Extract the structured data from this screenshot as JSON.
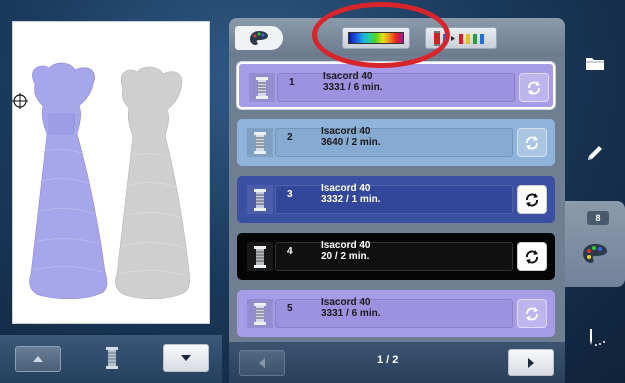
{
  "header": {
    "colorbar_button": "color-shuffle",
    "sort_button": "thread-sort"
  },
  "threads": [
    {
      "num": "1",
      "name": "Isacord 40",
      "info": "3331 / 6 min.",
      "row_color": "#a79ce8",
      "label_color": "#9d92e0",
      "text_color": "#1a1a1a",
      "selected": true
    },
    {
      "num": "2",
      "name": "Isacord 40",
      "info": "3640 / 2 min.",
      "row_color": "#8fb3da",
      "label_color": "#86aad1",
      "text_color": "#1a1a1a",
      "selected": false
    },
    {
      "num": "3",
      "name": "Isacord 40",
      "info": "3332 / 1 min.",
      "row_color": "#3b4fa3",
      "label_color": "#33479a",
      "text_color": "#ffffff",
      "selected": false
    },
    {
      "num": "4",
      "name": "Isacord 40",
      "info": "20 / 2 min.",
      "row_color": "#050505",
      "label_color": "#101010",
      "text_color": "#ffffff",
      "selected": false
    },
    {
      "num": "5",
      "name": "Isacord 40",
      "info": "3331 / 6 min.",
      "row_color": "#a79ce8",
      "label_color": "#9d92e0",
      "text_color": "#1a1a1a",
      "selected": false
    }
  ],
  "pager": {
    "text": "1 / 2"
  },
  "sidebar": {
    "color_count": "8"
  },
  "colors": {
    "highlight_ring": "#d8252c"
  }
}
